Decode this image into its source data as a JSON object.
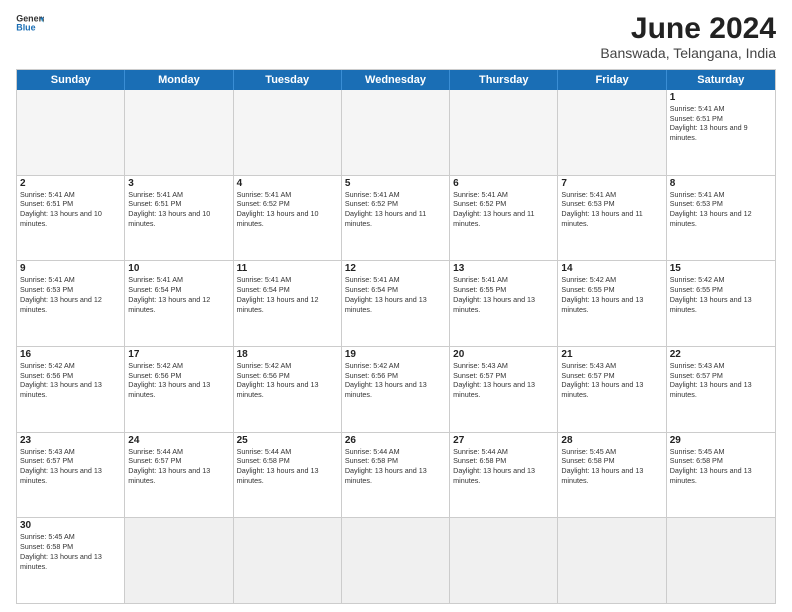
{
  "header": {
    "logo_general": "General",
    "logo_blue": "Blue",
    "title": "June 2024",
    "location": "Banswada, Telangana, India"
  },
  "days_of_week": [
    "Sunday",
    "Monday",
    "Tuesday",
    "Wednesday",
    "Thursday",
    "Friday",
    "Saturday"
  ],
  "weeks": [
    {
      "cells": [
        {
          "day": "",
          "empty": true
        },
        {
          "day": "",
          "empty": true
        },
        {
          "day": "",
          "empty": true
        },
        {
          "day": "",
          "empty": true
        },
        {
          "day": "",
          "empty": true
        },
        {
          "day": "",
          "empty": true
        },
        {
          "day": "1",
          "sunrise": "5:41 AM",
          "sunset": "6:51 PM",
          "daylight": "13 hours and 9 minutes."
        }
      ]
    },
    {
      "cells": [
        {
          "day": "2",
          "sunrise": "5:41 AM",
          "sunset": "6:51 PM",
          "daylight": "13 hours and 10 minutes."
        },
        {
          "day": "3",
          "sunrise": "5:41 AM",
          "sunset": "6:51 PM",
          "daylight": "13 hours and 10 minutes."
        },
        {
          "day": "4",
          "sunrise": "5:41 AM",
          "sunset": "6:52 PM",
          "daylight": "13 hours and 10 minutes."
        },
        {
          "day": "5",
          "sunrise": "5:41 AM",
          "sunset": "6:52 PM",
          "daylight": "13 hours and 11 minutes."
        },
        {
          "day": "6",
          "sunrise": "5:41 AM",
          "sunset": "6:52 PM",
          "daylight": "13 hours and 11 minutes."
        },
        {
          "day": "7",
          "sunrise": "5:41 AM",
          "sunset": "6:53 PM",
          "daylight": "13 hours and 11 minutes."
        },
        {
          "day": "8",
          "sunrise": "5:41 AM",
          "sunset": "6:53 PM",
          "daylight": "13 hours and 12 minutes."
        }
      ]
    },
    {
      "cells": [
        {
          "day": "9",
          "sunrise": "5:41 AM",
          "sunset": "6:53 PM",
          "daylight": "13 hours and 12 minutes."
        },
        {
          "day": "10",
          "sunrise": "5:41 AM",
          "sunset": "6:54 PM",
          "daylight": "13 hours and 12 minutes."
        },
        {
          "day": "11",
          "sunrise": "5:41 AM",
          "sunset": "6:54 PM",
          "daylight": "13 hours and 12 minutes."
        },
        {
          "day": "12",
          "sunrise": "5:41 AM",
          "sunset": "6:54 PM",
          "daylight": "13 hours and 13 minutes."
        },
        {
          "day": "13",
          "sunrise": "5:41 AM",
          "sunset": "6:55 PM",
          "daylight": "13 hours and 13 minutes."
        },
        {
          "day": "14",
          "sunrise": "5:42 AM",
          "sunset": "6:55 PM",
          "daylight": "13 hours and 13 minutes."
        },
        {
          "day": "15",
          "sunrise": "5:42 AM",
          "sunset": "6:55 PM",
          "daylight": "13 hours and 13 minutes."
        }
      ]
    },
    {
      "cells": [
        {
          "day": "16",
          "sunrise": "5:42 AM",
          "sunset": "6:56 PM",
          "daylight": "13 hours and 13 minutes."
        },
        {
          "day": "17",
          "sunrise": "5:42 AM",
          "sunset": "6:56 PM",
          "daylight": "13 hours and 13 minutes."
        },
        {
          "day": "18",
          "sunrise": "5:42 AM",
          "sunset": "6:56 PM",
          "daylight": "13 hours and 13 minutes."
        },
        {
          "day": "19",
          "sunrise": "5:42 AM",
          "sunset": "6:56 PM",
          "daylight": "13 hours and 13 minutes."
        },
        {
          "day": "20",
          "sunrise": "5:43 AM",
          "sunset": "6:57 PM",
          "daylight": "13 hours and 13 minutes."
        },
        {
          "day": "21",
          "sunrise": "5:43 AM",
          "sunset": "6:57 PM",
          "daylight": "13 hours and 13 minutes."
        },
        {
          "day": "22",
          "sunrise": "5:43 AM",
          "sunset": "6:57 PM",
          "daylight": "13 hours and 13 minutes."
        }
      ]
    },
    {
      "cells": [
        {
          "day": "23",
          "sunrise": "5:43 AM",
          "sunset": "6:57 PM",
          "daylight": "13 hours and 13 minutes."
        },
        {
          "day": "24",
          "sunrise": "5:44 AM",
          "sunset": "6:57 PM",
          "daylight": "13 hours and 13 minutes."
        },
        {
          "day": "25",
          "sunrise": "5:44 AM",
          "sunset": "6:58 PM",
          "daylight": "13 hours and 13 minutes."
        },
        {
          "day": "26",
          "sunrise": "5:44 AM",
          "sunset": "6:58 PM",
          "daylight": "13 hours and 13 minutes."
        },
        {
          "day": "27",
          "sunrise": "5:44 AM",
          "sunset": "6:58 PM",
          "daylight": "13 hours and 13 minutes."
        },
        {
          "day": "28",
          "sunrise": "5:45 AM",
          "sunset": "6:58 PM",
          "daylight": "13 hours and 13 minutes."
        },
        {
          "day": "29",
          "sunrise": "5:45 AM",
          "sunset": "6:58 PM",
          "daylight": "13 hours and 13 minutes."
        }
      ]
    },
    {
      "cells": [
        {
          "day": "30",
          "sunrise": "5:45 AM",
          "sunset": "6:58 PM",
          "daylight": "13 hours and 13 minutes."
        },
        {
          "day": "",
          "empty": true
        },
        {
          "day": "",
          "empty": true
        },
        {
          "day": "",
          "empty": true
        },
        {
          "day": "",
          "empty": true
        },
        {
          "day": "",
          "empty": true
        },
        {
          "day": "",
          "empty": true
        }
      ]
    }
  ]
}
